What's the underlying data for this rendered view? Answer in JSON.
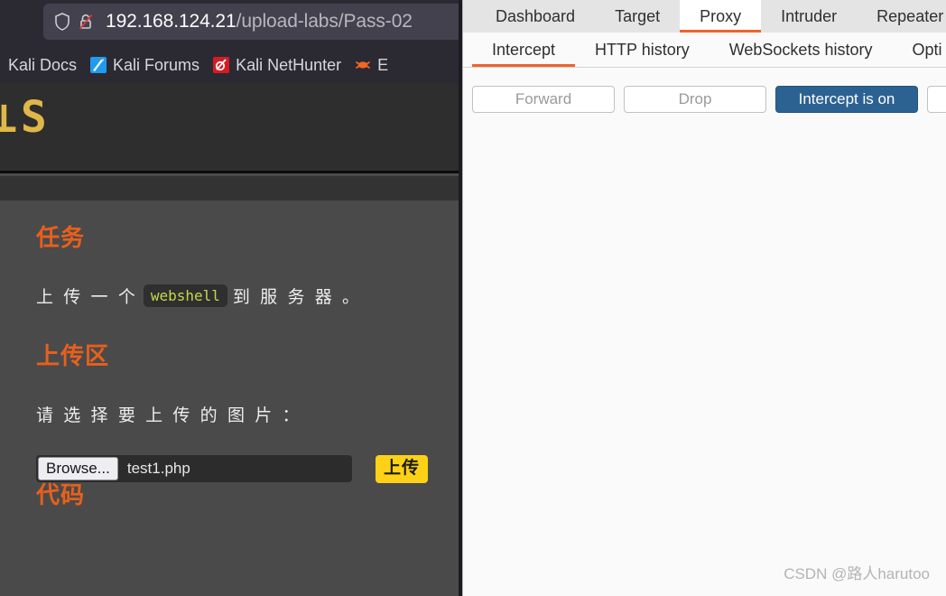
{
  "browser": {
    "urlbar": {
      "shield_icon": "shield-icon",
      "lock_icon": "lock-crossed-icon",
      "host": "192.168.124.21",
      "path": "/upload-labs/Pass-02",
      "full_url": "192.168.124.21/upload-labs/Pass-02"
    },
    "bookmarks": [
      {
        "label": "Kali Docs",
        "icon": "kali-docs-icon"
      },
      {
        "label": "Kali Forums",
        "icon": "kali-forums-icon"
      },
      {
        "label": "Kali NetHunter",
        "icon": "kali-nethunter-icon"
      },
      {
        "label": "E",
        "icon": "exploit-db-bug-icon"
      }
    ]
  },
  "page": {
    "logo_fragment": "⊥S",
    "task_heading": "任务",
    "task_text_before": "上 传 一 个",
    "task_code": "webshell",
    "task_text_after": "到 服 务 器 。",
    "upload_heading": "上传区",
    "file_prompt": "请 选 择 要 上 传 的 图 片 ：",
    "browse_button": "Browse...",
    "file_name": "test1.php",
    "upload_button": "上传",
    "code_heading": "代码"
  },
  "burp": {
    "tabs": [
      {
        "label": "Dashboard",
        "active": false
      },
      {
        "label": "Target",
        "active": false
      },
      {
        "label": "Proxy",
        "active": true
      },
      {
        "label": "Intruder",
        "active": false
      },
      {
        "label": "Repeater",
        "active": false
      }
    ],
    "subtabs": [
      {
        "label": "Intercept",
        "active": true
      },
      {
        "label": "HTTP history",
        "active": false
      },
      {
        "label": "WebSockets history",
        "active": false
      },
      {
        "label": "Opti",
        "active": false
      }
    ],
    "buttons": [
      {
        "label": "Forward",
        "style": "disabled"
      },
      {
        "label": "Drop",
        "style": "disabled"
      },
      {
        "label": "Intercept is on",
        "style": "primary"
      },
      {
        "label": "",
        "style": "blank"
      }
    ]
  },
  "watermark": "CSDN @路人harutoo",
  "colors": {
    "accent_orange": "#e8601c",
    "burp_orange": "#f0632b",
    "upload_yellow": "#fcd116",
    "burp_blue": "#2c6291",
    "logo_gold": "#e0b749",
    "code_green": "#c7d84a"
  }
}
